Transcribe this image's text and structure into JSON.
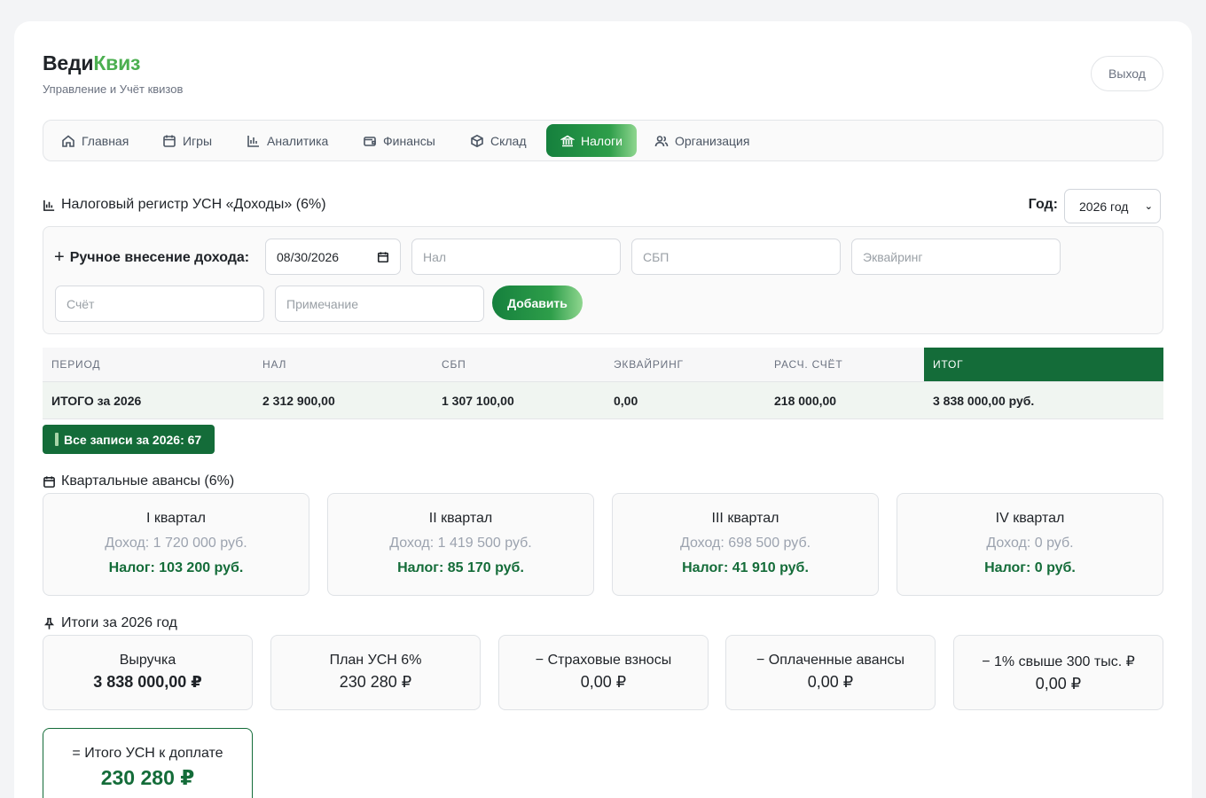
{
  "brand": {
    "part1": "Веди",
    "part2": "Квиз",
    "subtitle": "Управление и Учёт квизов",
    "accent": "#4caf50"
  },
  "header": {
    "logout_label": "Выход"
  },
  "nav": {
    "items": [
      {
        "label": "Главная",
        "icon": "home-icon"
      },
      {
        "label": "Игры",
        "icon": "calendar-icon"
      },
      {
        "label": "Аналитика",
        "icon": "bar-chart-icon"
      },
      {
        "label": "Финансы",
        "icon": "wallet-icon"
      },
      {
        "label": "Склад",
        "icon": "box-icon"
      },
      {
        "label": "Налоги",
        "icon": "bank-icon",
        "active": true
      },
      {
        "label": "Организация",
        "icon": "users-icon"
      }
    ]
  },
  "register": {
    "title": "Налоговый регистр УСН «Доходы» (6%)",
    "year_label": "Год:",
    "year_value": "2026 год"
  },
  "manual": {
    "label": "Ручное внесение дохода:",
    "date_value": "08/30/2026",
    "cash_placeholder": "Нал",
    "sbp_placeholder": "СБП",
    "acquiring_placeholder": "Эквайринг",
    "account_placeholder": "Счёт",
    "note_placeholder": "Примечание",
    "add_label": "Добавить"
  },
  "table": {
    "headers": [
      "ПЕРИОД",
      "НАЛ",
      "СБП",
      "ЭКВАЙРИНГ",
      "РАСЧ. СЧЁТ",
      "ИТОГ"
    ],
    "total_row": [
      "ИТОГО за 2026",
      "2 312 900,00",
      "1 307 100,00",
      "0,00",
      "218 000,00",
      "3 838 000,00 руб."
    ]
  },
  "all_records_label": "Все записи за 2026: 67",
  "quarters": {
    "title": "Квартальные авансы (6%)",
    "items": [
      {
        "name": "I квартал",
        "income": "Доход: 1 720 000 руб.",
        "tax": "Налог: 103 200 руб."
      },
      {
        "name": "II квартал",
        "income": "Доход: 1 419 500 руб.",
        "tax": "Налог: 85 170 руб."
      },
      {
        "name": "III квартал",
        "income": "Доход: 698 500 руб.",
        "tax": "Налог: 41 910 руб."
      },
      {
        "name": "IV квартал",
        "income": "Доход: 0 руб.",
        "tax": "Налог: 0 руб."
      }
    ]
  },
  "summary": {
    "title": "Итоги за 2026 год",
    "items": [
      {
        "label": "Выручка",
        "value": "3 838 000,00 ₽"
      },
      {
        "label": "План УСН 6%",
        "value": "230 280 ₽"
      },
      {
        "label": "− Страховые взносы",
        "value": "0,00 ₽"
      },
      {
        "label": "− Оплаченные авансы",
        "value": "0,00 ₽"
      },
      {
        "label": "− 1% свыше 300 тыс. ₽",
        "value": "0,00 ₽"
      }
    ],
    "final_label": "= Итого УСН к доплате",
    "final_value": "230 280 ₽"
  },
  "colors": {
    "primary": "#146c39",
    "active_gradient_end": "#8fd68f",
    "muted": "#9ca3af"
  }
}
